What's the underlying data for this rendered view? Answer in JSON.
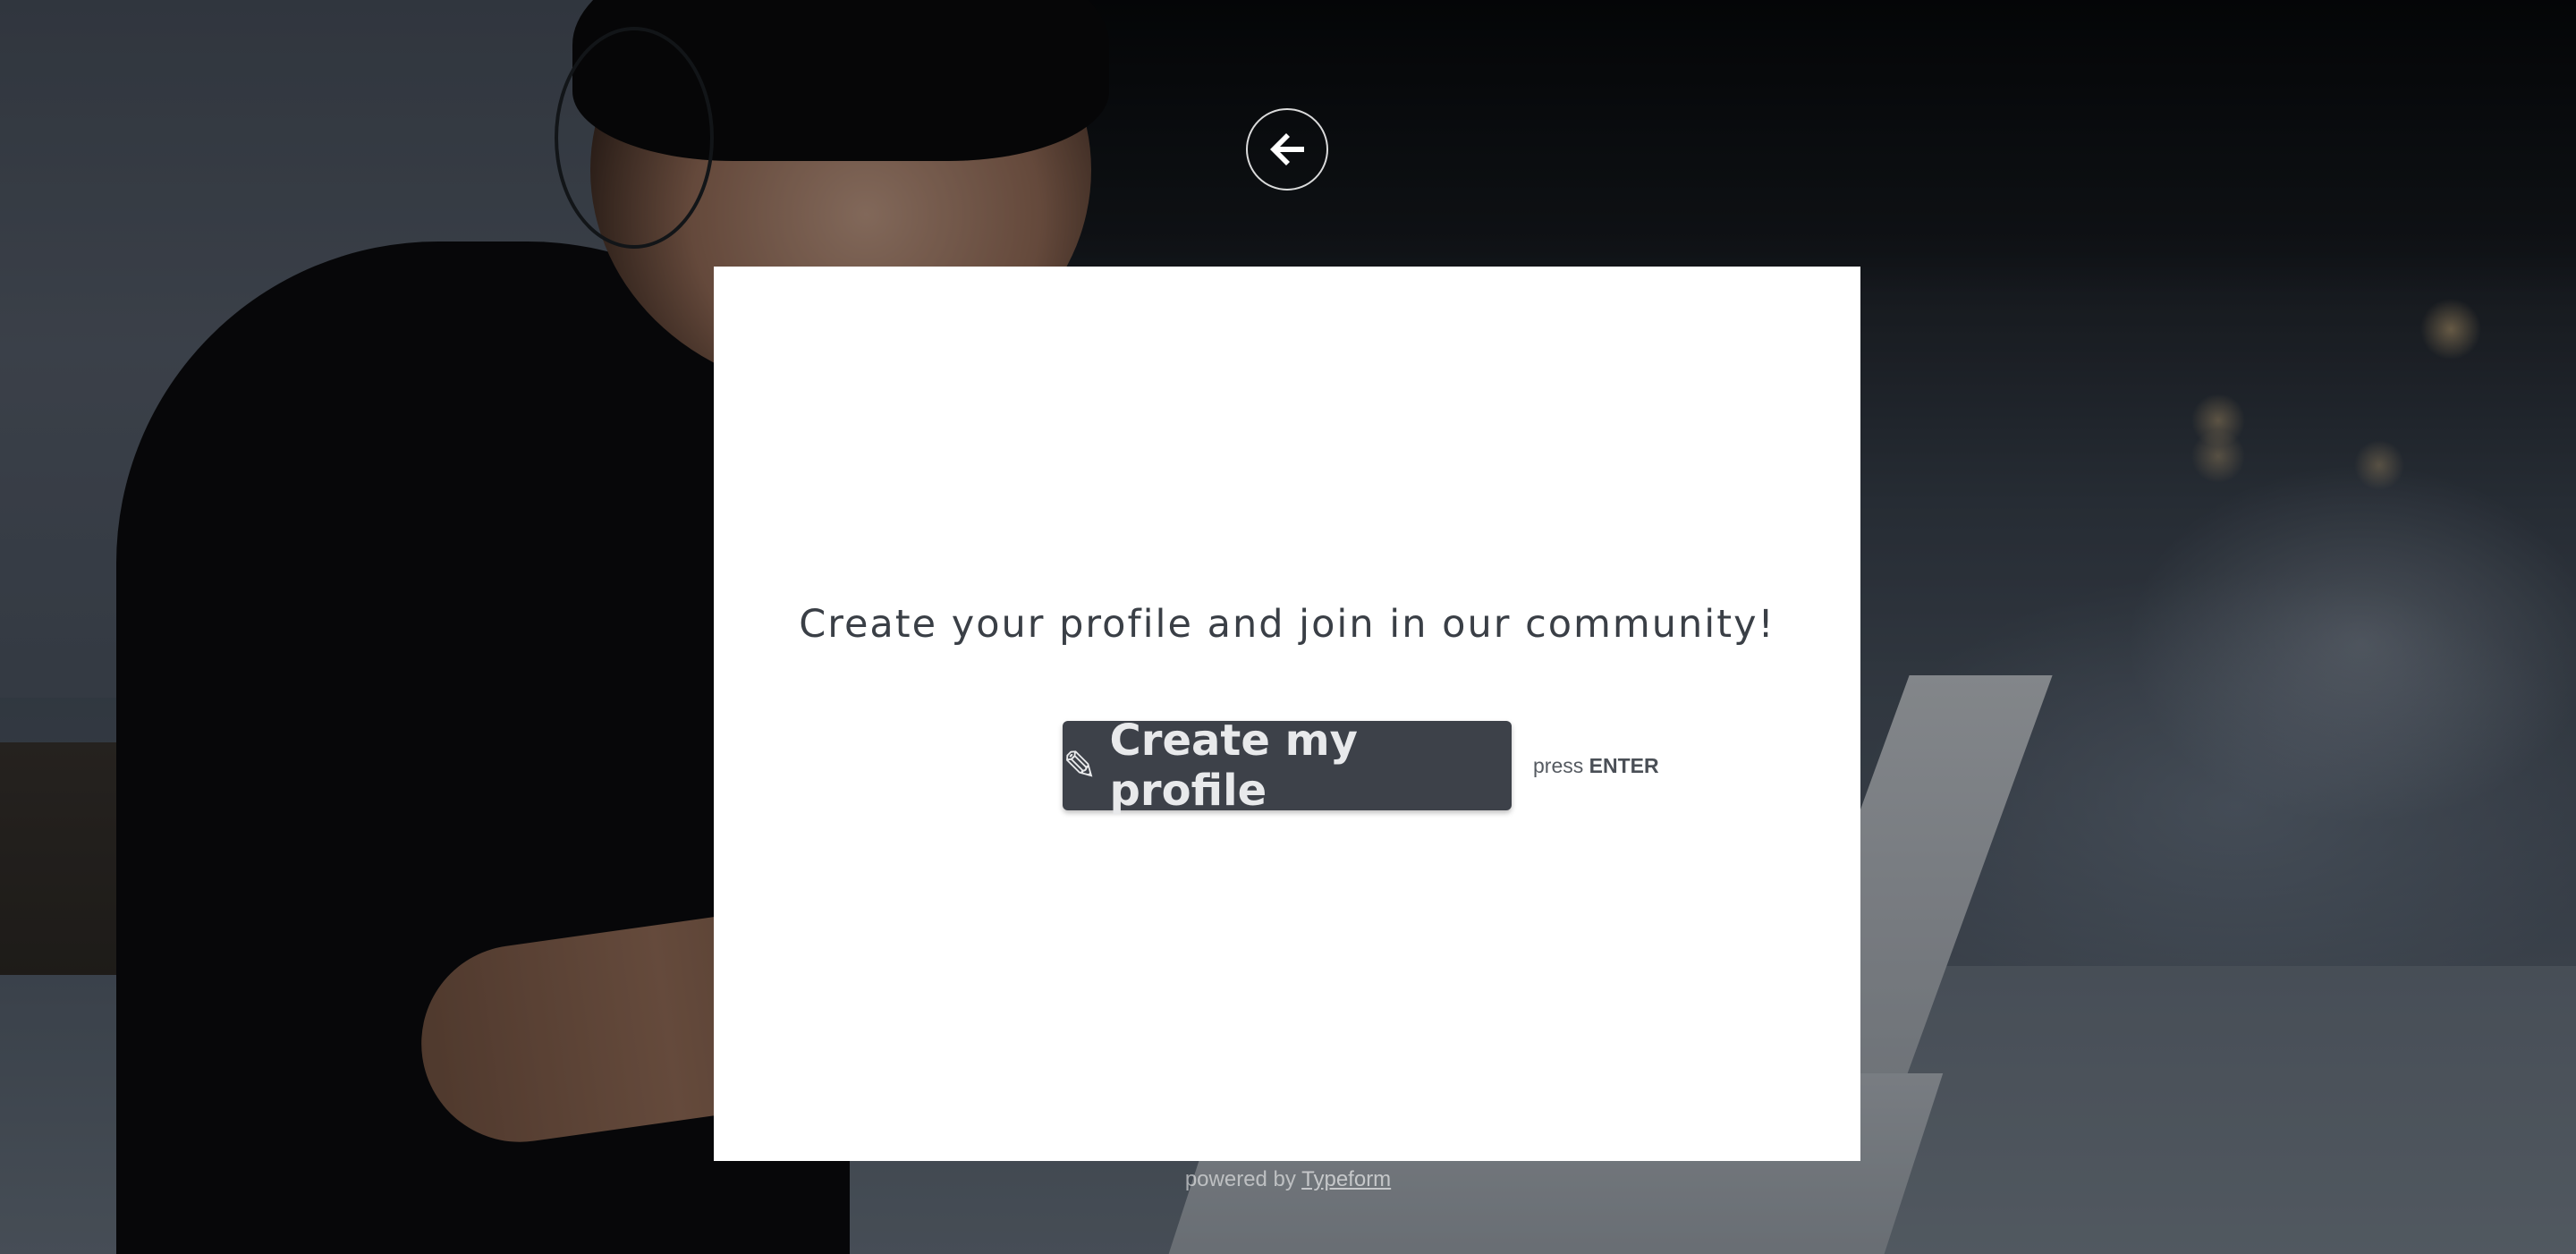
{
  "welcome": {
    "message": "Create your profile and join in our community!"
  },
  "cta": {
    "icon": "pencil-icon",
    "glyph": "✎",
    "label": "Create my profile",
    "hint_prefix": "press",
    "hint_key": "ENTER"
  },
  "navigation": {
    "back_icon": "arrow-left-icon"
  },
  "footer": {
    "powered_prefix": "powered by",
    "brand_link": "Typeform"
  },
  "colors": {
    "button_bg": "#3d4149",
    "button_text": "#e8e9eb",
    "card_bg": "#ffffff",
    "text": "#3a3f46"
  }
}
